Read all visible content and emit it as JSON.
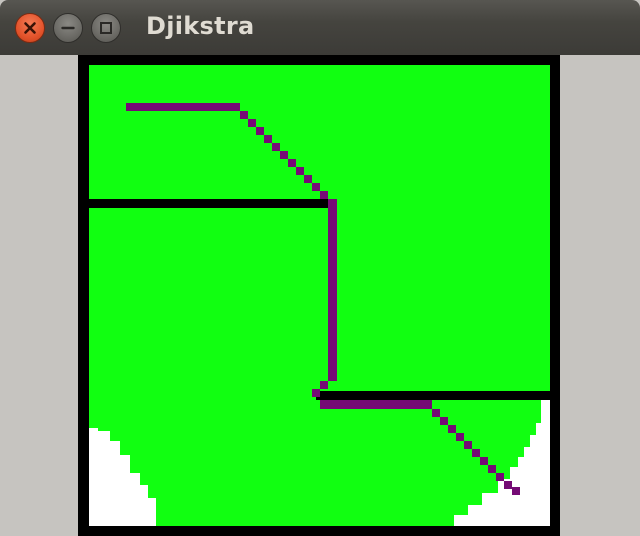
{
  "window": {
    "title": "Djikstra",
    "controls": [
      "close-icon",
      "minimize-icon",
      "maximize-icon"
    ]
  },
  "grid": {
    "colors": {
      "background": "#000000",
      "explored": "#11ff11",
      "unexplored": "#ffffff",
      "path": "#750a75",
      "wall": "#000000",
      "window_bg": "#c6c4c0",
      "titlebar": "#3c3b37",
      "close_button": "#e3532b"
    }
  }
}
